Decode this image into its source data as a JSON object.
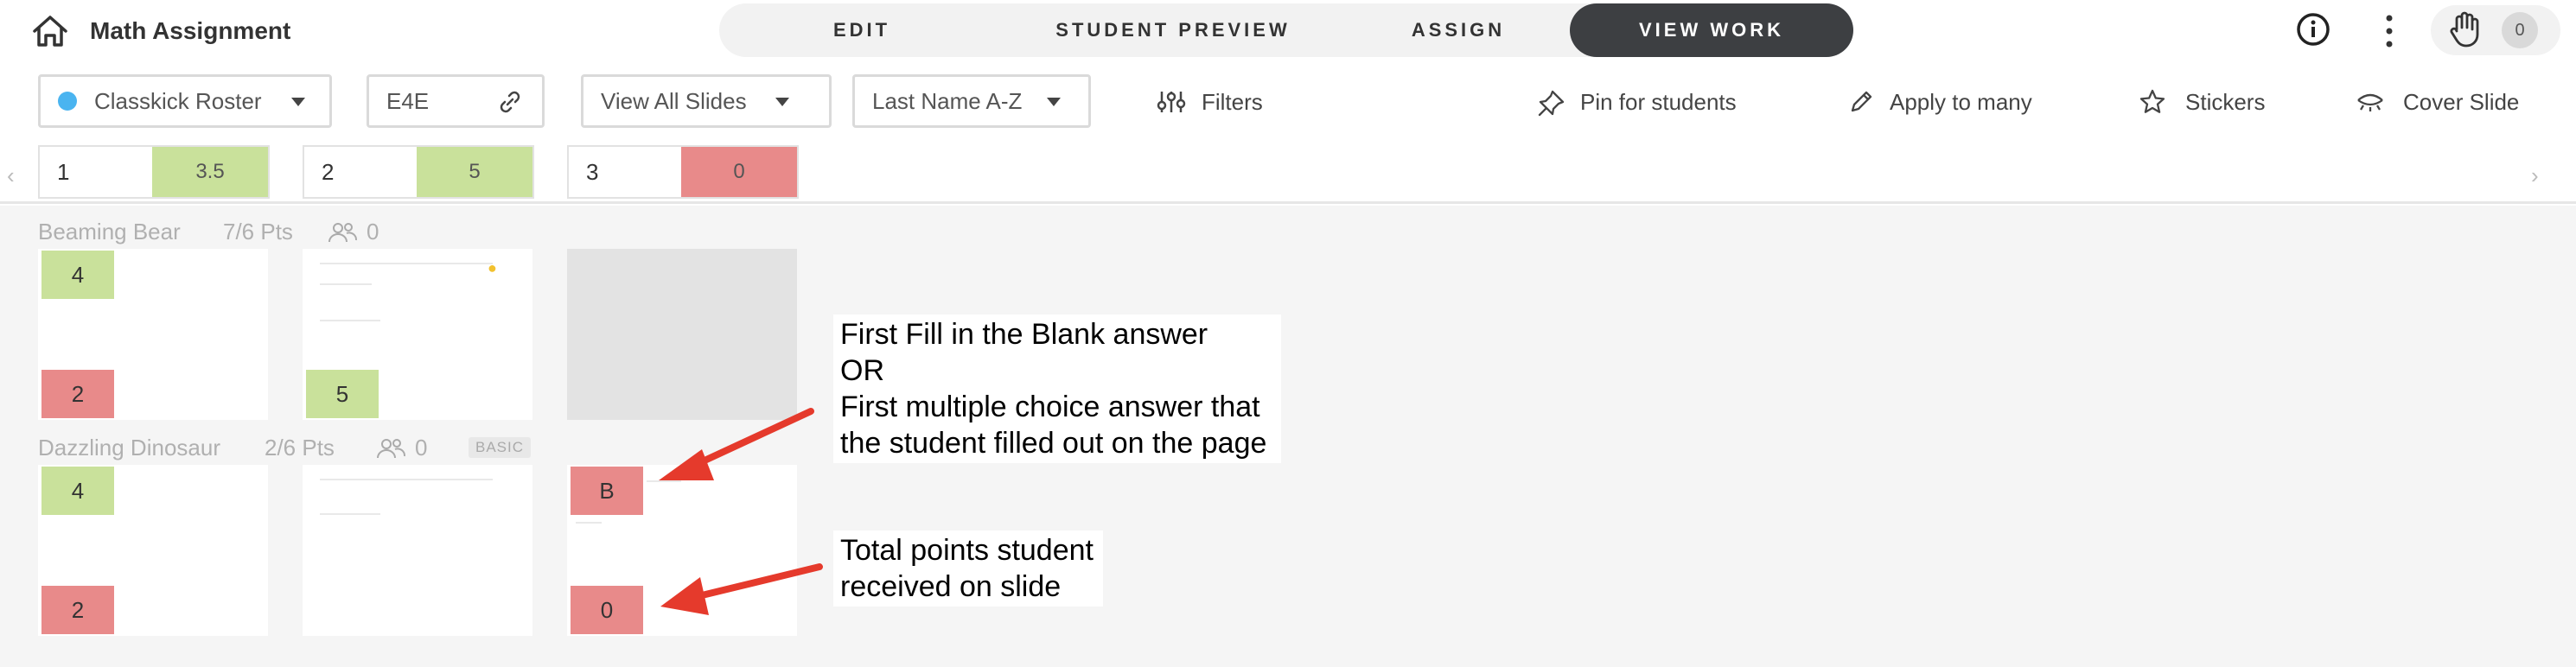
{
  "header": {
    "title": "Math Assignment",
    "tabs": [
      {
        "label": "EDIT",
        "active": false
      },
      {
        "label": "STUDENT PREVIEW",
        "active": false
      },
      {
        "label": "ASSIGN",
        "active": false
      },
      {
        "label": "VIEW WORK",
        "active": true
      }
    ],
    "hand_count": "0"
  },
  "toolbar": {
    "roster": "Classkick Roster",
    "code": "E4E",
    "slides_filter": "View All Slides",
    "sort": "Last Name A-Z",
    "filters": "Filters",
    "pin": "Pin for students",
    "apply": "Apply to many",
    "stickers": "Stickers",
    "cover": "Cover Slide"
  },
  "slides": [
    {
      "number": "1",
      "score": "3.5",
      "status": "green"
    },
    {
      "number": "2",
      "score": "5",
      "status": "green"
    },
    {
      "number": "3",
      "score": "0",
      "status": "red"
    }
  ],
  "students": [
    {
      "name": "Beaming Bear",
      "points": "7/6 Pts",
      "helpers": "0",
      "badge": "",
      "thumbs": [
        {
          "answer": "4",
          "answer_status": "green",
          "total": "2",
          "total_status": "red"
        },
        {
          "answer": "",
          "total": "5",
          "total_status": "green"
        },
        {
          "answer": "",
          "total": ""
        }
      ]
    },
    {
      "name": "Dazzling Dinosaur",
      "points": "2/6 Pts",
      "helpers": "0",
      "badge": "BASIC",
      "thumbs": [
        {
          "answer": "4",
          "answer_status": "green",
          "total": "2",
          "total_status": "red"
        },
        {
          "answer": "",
          "total": ""
        },
        {
          "answer": "B",
          "answer_status": "red",
          "total": "0",
          "total_status": "red"
        }
      ]
    }
  ],
  "annotations": {
    "answer_note": [
      "First Fill in the Blank answer",
      "OR",
      "First multiple choice answer that",
      "the student filled out on the page"
    ],
    "total_note": [
      "Total points student",
      "received on slide"
    ]
  },
  "colors": {
    "green": "#c9e19b",
    "red": "#e88a8a",
    "active_tab": "#3d3f42",
    "roster_dot": "#4ab4f0",
    "arrow": "#e53a2c"
  }
}
